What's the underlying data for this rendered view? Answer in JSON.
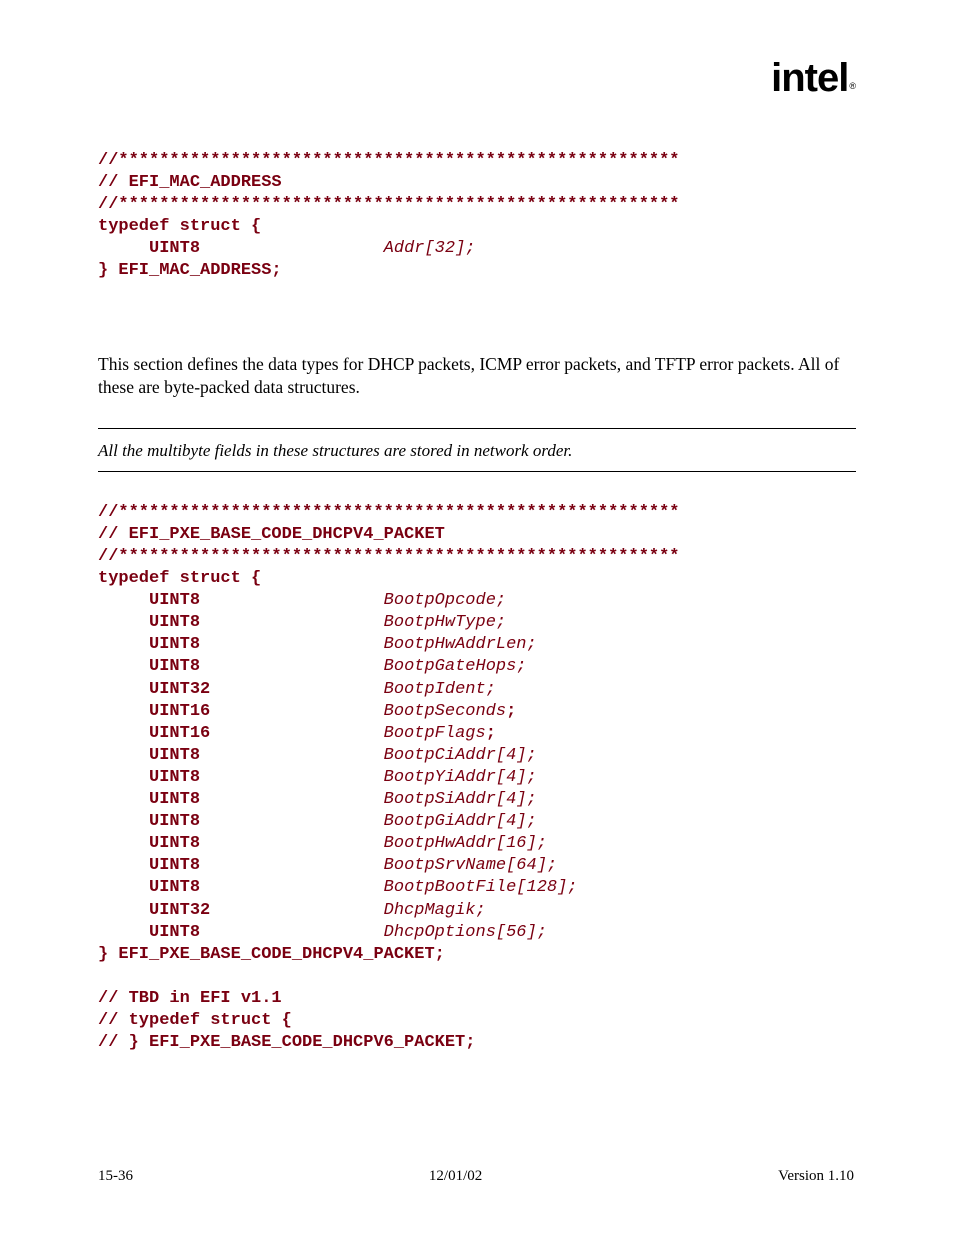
{
  "logo": "intel",
  "code1": {
    "l1": "//*******************************************************",
    "l2": "// EFI_MAC_ADDRESS",
    "l3": "//*******************************************************",
    "l4": "typedef struct {",
    "l5_kw": "     UINT8",
    "l5_fld": "                  Addr[32];",
    "l6": "} EFI_MAC_ADDRESS;"
  },
  "para1": "This section defines the data types for DHCP packets, ICMP error packets, and TFTP error packets. All of these are byte-packed data structures.",
  "note": "All the multibyte fields in these structures are stored in network order.",
  "code2": {
    "l1": "//*******************************************************",
    "l2": "// EFI_PXE_BASE_CODE_DHCPV4_PACKET",
    "l3": "//*******************************************************",
    "l4": "typedef struct {",
    "rows": [
      {
        "t": "UINT8",
        "f": "BootpOpcode;"
      },
      {
        "t": "UINT8",
        "f": "BootpHwType;"
      },
      {
        "t": "UINT8",
        "f": "BootpHwAddrLen;"
      },
      {
        "t": "UINT8",
        "f": "BootpGateHops;"
      },
      {
        "t": "UINT32",
        "f": "BootpIdent;"
      },
      {
        "t": "UINT16",
        "f": "BootpSeconds",
        "sc": true
      },
      {
        "t": "UINT16",
        "f": "BootpFlags",
        "sc": true
      },
      {
        "t": "UINT8",
        "f": "BootpCiAddr[4];"
      },
      {
        "t": "UINT8",
        "f": "BootpYiAddr[4];"
      },
      {
        "t": "UINT8",
        "f": "BootpSiAddr[4];"
      },
      {
        "t": "UINT8",
        "f": "BootpGiAddr[4];"
      },
      {
        "t": "UINT8",
        "f": "BootpHwAddr[16];"
      },
      {
        "t": "UINT8",
        "f": "BootpSrvName[64];"
      },
      {
        "t": "UINT8",
        "f": "BootpBootFile[128];"
      },
      {
        "t": "UINT32",
        "f": "DhcpMagik;"
      },
      {
        "t": "UINT8",
        "f": "DhcpOptions[56];"
      }
    ],
    "l_end": "} EFI_PXE_BASE_CODE_DHCPV4_PACKET;",
    "l_b1": "// TBD in EFI v1.1",
    "l_b2": "// typedef struct {",
    "l_b3": "// } EFI_PXE_BASE_CODE_DHCPV6_PACKET;"
  },
  "footer": {
    "left": "15-36",
    "center": "12/01/02",
    "right": "Version 1.10"
  }
}
